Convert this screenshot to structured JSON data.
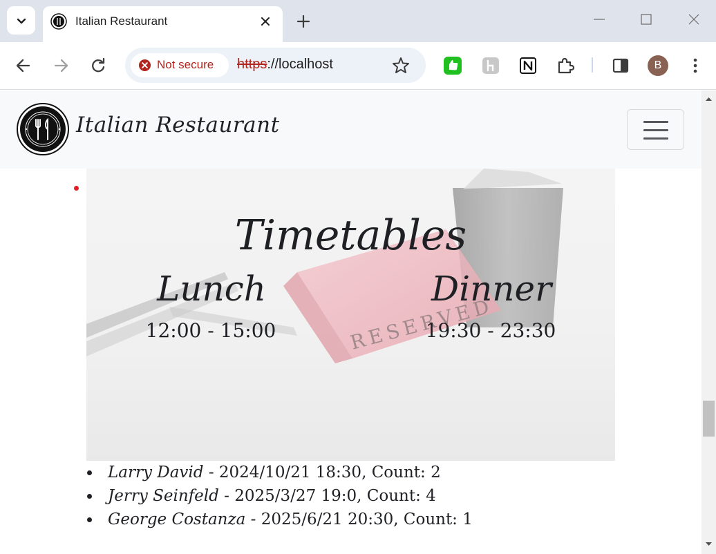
{
  "browser": {
    "tab_title": "Italian Restaurant",
    "security_chip": "Not secure",
    "url_scheme": "https",
    "url_rest": "://localhost",
    "profile_initial": "B"
  },
  "site": {
    "brand": "Italian Restaurant"
  },
  "timetables": {
    "title": "Timetables",
    "lunch": {
      "label": "Lunch",
      "hours": "12:00 - 15:00"
    },
    "dinner": {
      "label": "Dinner",
      "hours": "19:30 - 23:30"
    },
    "sign_text": "RESERVED"
  },
  "reservations": [
    {
      "name": "Larry David",
      "details": " - 2024/10/21 18:30, Count: 2"
    },
    {
      "name": "Jerry Seinfeld",
      "details": " - 2025/3/27 19:0, Count: 4"
    },
    {
      "name": "George Costanza",
      "details": " - 2025/6/21 20:30, Count: 1"
    }
  ],
  "colors": {
    "accent_red": "#e01f26",
    "security_red": "#b3261e",
    "text_dark": "#1e2024",
    "navbar_bg": "#f8f9fa"
  }
}
